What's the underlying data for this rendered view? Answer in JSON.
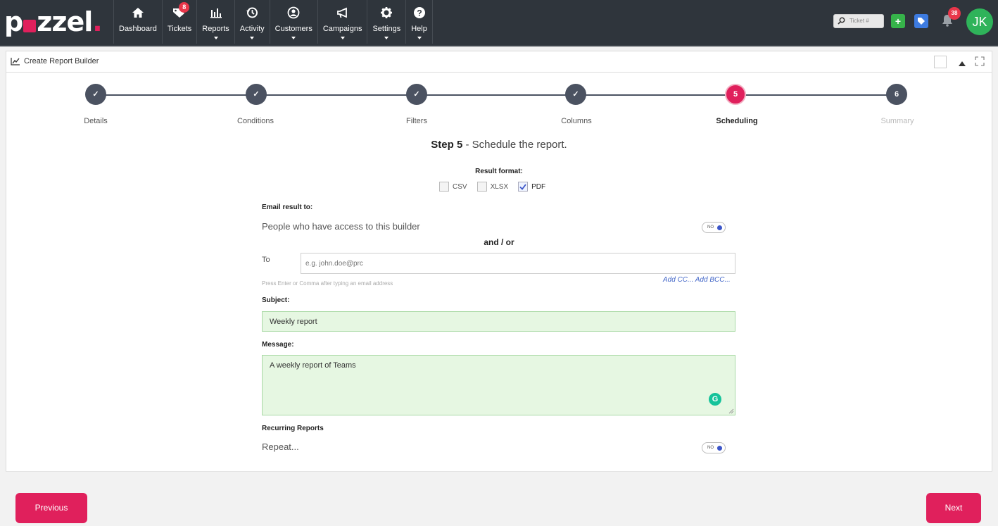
{
  "brand": {
    "logo_text_1": "p",
    "logo_text_2": "zzel",
    "logo_dot": ".",
    "accent": "#e0205c"
  },
  "nav": {
    "items": [
      {
        "label": "Dashboard",
        "icon": "home-icon",
        "caret": false
      },
      {
        "label": "Tickets",
        "icon": "tag-icon",
        "caret": false,
        "badge": "8"
      },
      {
        "label": "Reports",
        "icon": "bar-chart-icon",
        "caret": true
      },
      {
        "label": "Activity",
        "icon": "history-icon",
        "caret": true
      },
      {
        "label": "Customers",
        "icon": "user-circle-icon",
        "caret": true
      },
      {
        "label": "Campaigns",
        "icon": "megaphone-icon",
        "caret": true
      },
      {
        "label": "Settings",
        "icon": "gear-icon",
        "caret": true
      },
      {
        "label": "Help",
        "icon": "question-icon",
        "caret": true
      }
    ],
    "ticket_placeholder": "Ticket #",
    "notifications_count": "38",
    "avatar_initials": "JK"
  },
  "panel": {
    "title": "Create Report Builder"
  },
  "steps": [
    {
      "label": "Details",
      "state": "done",
      "mark": "✓"
    },
    {
      "label": "Conditions",
      "state": "done",
      "mark": "✓"
    },
    {
      "label": "Filters",
      "state": "done",
      "mark": "✓"
    },
    {
      "label": "Columns",
      "state": "done",
      "mark": "✓"
    },
    {
      "label": "Scheduling",
      "state": "active",
      "mark": "5"
    },
    {
      "label": "Summary",
      "state": "future",
      "mark": "6"
    }
  ],
  "heading": {
    "step": "Step 5",
    "rest": " - Schedule the report."
  },
  "result_format": {
    "label": "Result format:",
    "options": [
      {
        "label": "CSV",
        "checked": false
      },
      {
        "label": "XLSX",
        "checked": false
      },
      {
        "label": "PDF",
        "checked": true
      }
    ]
  },
  "email": {
    "label": "Email result to:",
    "people_text": "People who have access to this builder",
    "people_toggle": "NO",
    "and_or": "and / or",
    "to_label": "To",
    "to_placeholder": "e.g. john.doe@prc",
    "hint": "Press Enter or Comma after typing an email address",
    "cc_link": "Add CC... Add BCC..."
  },
  "subject": {
    "label": "Subject:",
    "value": "Weekly report"
  },
  "message": {
    "label": "Message:",
    "value": "A weekly report of Teams"
  },
  "recurring": {
    "label": "Recurring Reports",
    "text": "Repeat...",
    "toggle": "NO"
  },
  "footer": {
    "previous": "Previous",
    "next": "Next"
  }
}
